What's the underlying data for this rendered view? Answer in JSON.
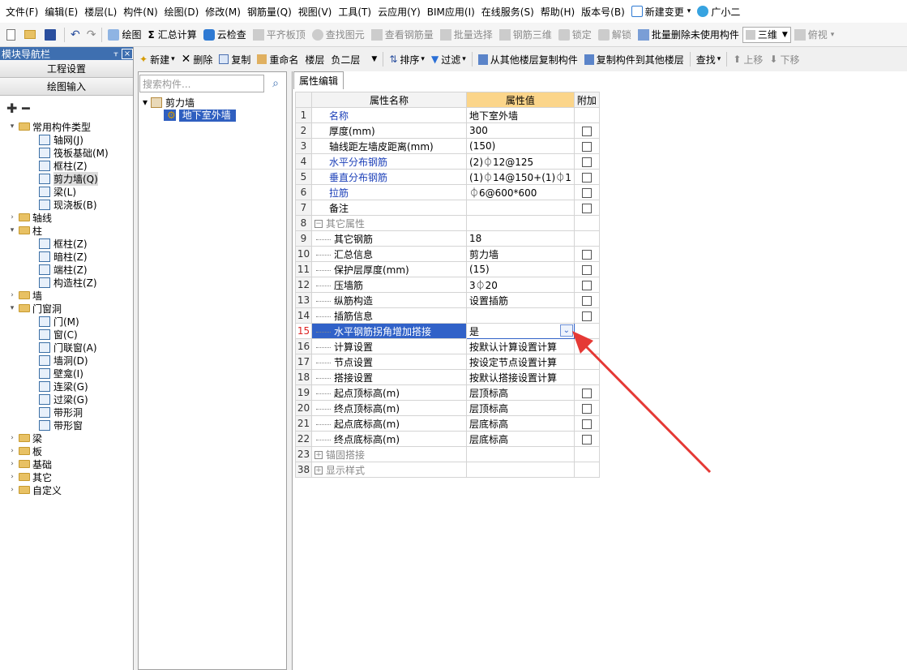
{
  "menu": [
    "文件(F)",
    "编辑(E)",
    "楼层(L)",
    "构件(N)",
    "绘图(D)",
    "修改(M)",
    "钢筋量(Q)",
    "视图(V)",
    "工具(T)",
    "云应用(Y)",
    "BIM应用(I)",
    "在线服务(S)",
    "帮助(H)",
    "版本号(B)"
  ],
  "menu_extra": {
    "new_change": "新建变更",
    "dropdown": "▾",
    "assistant": "广小二"
  },
  "toolbar1": {
    "draw": "绘图",
    "calc": "汇总计算",
    "cloud_check": "云检查",
    "align_top": "平齐板顶",
    "find_elem": "查找图元",
    "view_rebar": "查看钢筋量",
    "batch_select": "批量选择",
    "rebar_3d": "钢筋三维",
    "lock": "锁定",
    "unlock": "解锁",
    "batch_delete": "批量删除未使用构件",
    "view_mode": "三维",
    "view_dir": "俯视"
  },
  "toolbar2": {
    "new": "新建",
    "delete": "删除",
    "copy": "复制",
    "rename": "重命名",
    "floor_label": "楼层",
    "floor_value": "负二层",
    "sort": "排序",
    "filter": "过滤",
    "copy_from": "从其他楼层复制构件",
    "copy_to": "复制构件到其他楼层",
    "find": "查找",
    "up": "上移",
    "down": "下移"
  },
  "nav": {
    "title": "模块导航栏",
    "pin": "ᚁ",
    "close": "×",
    "btn_project": "工程设置",
    "btn_draw": "绘图输入",
    "tools": "✚ ━",
    "tree": [
      {
        "level": 0,
        "exp": "▾",
        "folder": true,
        "label": "常用构件类型"
      },
      {
        "level": 1,
        "label": "轴网(J)"
      },
      {
        "level": 1,
        "label": "筏板基础(M)"
      },
      {
        "level": 1,
        "label": "框柱(Z)"
      },
      {
        "level": 1,
        "label": "剪力墙(Q)",
        "selected": true
      },
      {
        "level": 1,
        "label": "梁(L)"
      },
      {
        "level": 1,
        "label": "现浇板(B)"
      },
      {
        "level": 0,
        "exp": "›",
        "folder": true,
        "label": "轴线"
      },
      {
        "level": 0,
        "exp": "▾",
        "folder": true,
        "label": "柱"
      },
      {
        "level": 1,
        "label": "框柱(Z)"
      },
      {
        "level": 1,
        "label": "暗柱(Z)"
      },
      {
        "level": 1,
        "label": "端柱(Z)"
      },
      {
        "level": 1,
        "label": "构造柱(Z)"
      },
      {
        "level": 0,
        "exp": "›",
        "folder": true,
        "label": "墙"
      },
      {
        "level": 0,
        "exp": "▾",
        "folder": true,
        "label": "门窗洞"
      },
      {
        "level": 1,
        "label": "门(M)"
      },
      {
        "level": 1,
        "label": "窗(C)"
      },
      {
        "level": 1,
        "label": "门联窗(A)"
      },
      {
        "level": 1,
        "label": "墙洞(D)"
      },
      {
        "level": 1,
        "label": "壁龛(I)"
      },
      {
        "level": 1,
        "label": "连梁(G)"
      },
      {
        "level": 1,
        "label": "过梁(G)"
      },
      {
        "level": 1,
        "label": "带形洞"
      },
      {
        "level": 1,
        "label": "带形窗"
      },
      {
        "level": 0,
        "exp": "›",
        "folder": true,
        "label": "梁"
      },
      {
        "level": 0,
        "exp": "›",
        "folder": true,
        "label": "板"
      },
      {
        "level": 0,
        "exp": "›",
        "folder": true,
        "label": "基础"
      },
      {
        "level": 0,
        "exp": "›",
        "folder": true,
        "label": "其它"
      },
      {
        "level": 0,
        "exp": "›",
        "folder": true,
        "label": "自定义"
      }
    ]
  },
  "complist": {
    "search_placeholder": "搜索构件...",
    "root": "剪力墙",
    "child": "地下室外墙"
  },
  "props": {
    "tab": "属性编辑",
    "col_name": "属性名称",
    "col_value": "属性值",
    "col_add": "附加",
    "rows": [
      {
        "n": "1",
        "name": "名称",
        "value": "地下室外墙",
        "blue": true,
        "cb": false
      },
      {
        "n": "2",
        "name": "厚度(mm)",
        "value": "300",
        "cb": true
      },
      {
        "n": "3",
        "name": "轴线距左墙皮距离(mm)",
        "value": "(150)",
        "cb": true
      },
      {
        "n": "4",
        "name": "水平分布钢筋",
        "value": "(2)⏀12@125",
        "blue": true,
        "cb": true
      },
      {
        "n": "5",
        "name": "垂直分布钢筋",
        "value": "(1)⏀14@150+(1)⏀1",
        "blue": true,
        "cb": true
      },
      {
        "n": "6",
        "name": "拉筋",
        "value": "⏀6@600*600",
        "blue": true,
        "cb": true
      },
      {
        "n": "7",
        "name": "备注",
        "value": "",
        "cb": true
      },
      {
        "n": "8",
        "name": "其它属性",
        "value": "",
        "group": "−",
        "gray": true
      },
      {
        "n": "9",
        "name": "其它钢筋",
        "value": "18",
        "child": true
      },
      {
        "n": "10",
        "name": "汇总信息",
        "value": "剪力墙",
        "child": true,
        "cb": true
      },
      {
        "n": "11",
        "name": "保护层厚度(mm)",
        "value": "(15)",
        "child": true,
        "cb": true
      },
      {
        "n": "12",
        "name": "压墙筋",
        "value": "3⏀20",
        "child": true,
        "cb": true
      },
      {
        "n": "13",
        "name": "纵筋构造",
        "value": "设置插筋",
        "child": true,
        "cb": true
      },
      {
        "n": "14",
        "name": "插筋信息",
        "value": "",
        "child": true,
        "cb": true
      },
      {
        "n": "15",
        "name": "水平钢筋拐角增加搭接",
        "value": "是",
        "child": true,
        "highlight": true
      },
      {
        "n": "16",
        "name": "计算设置",
        "value": "按默认计算设置计算",
        "child": true
      },
      {
        "n": "17",
        "name": "节点设置",
        "value": "按设定节点设置计算",
        "child": true
      },
      {
        "n": "18",
        "name": "搭接设置",
        "value": "按默认搭接设置计算",
        "child": true
      },
      {
        "n": "19",
        "name": "起点顶标高(m)",
        "value": "层顶标高",
        "child": true,
        "cb": true
      },
      {
        "n": "20",
        "name": "终点顶标高(m)",
        "value": "层顶标高",
        "child": true,
        "cb": true
      },
      {
        "n": "21",
        "name": "起点底标高(m)",
        "value": "层底标高",
        "child": true,
        "cb": true
      },
      {
        "n": "22",
        "name": "终点底标高(m)",
        "value": "层底标高",
        "child": true,
        "cb": true
      },
      {
        "n": "23",
        "name": "锚固搭接",
        "value": "",
        "group": "+",
        "gray": true
      },
      {
        "n": "38",
        "name": "显示样式",
        "value": "",
        "group": "+",
        "gray": true
      }
    ]
  },
  "colors": {
    "accent": "#3162c8",
    "header_value": "#fbd58a",
    "blue_text": "#1b3fb8",
    "arrow": "#e53935"
  }
}
